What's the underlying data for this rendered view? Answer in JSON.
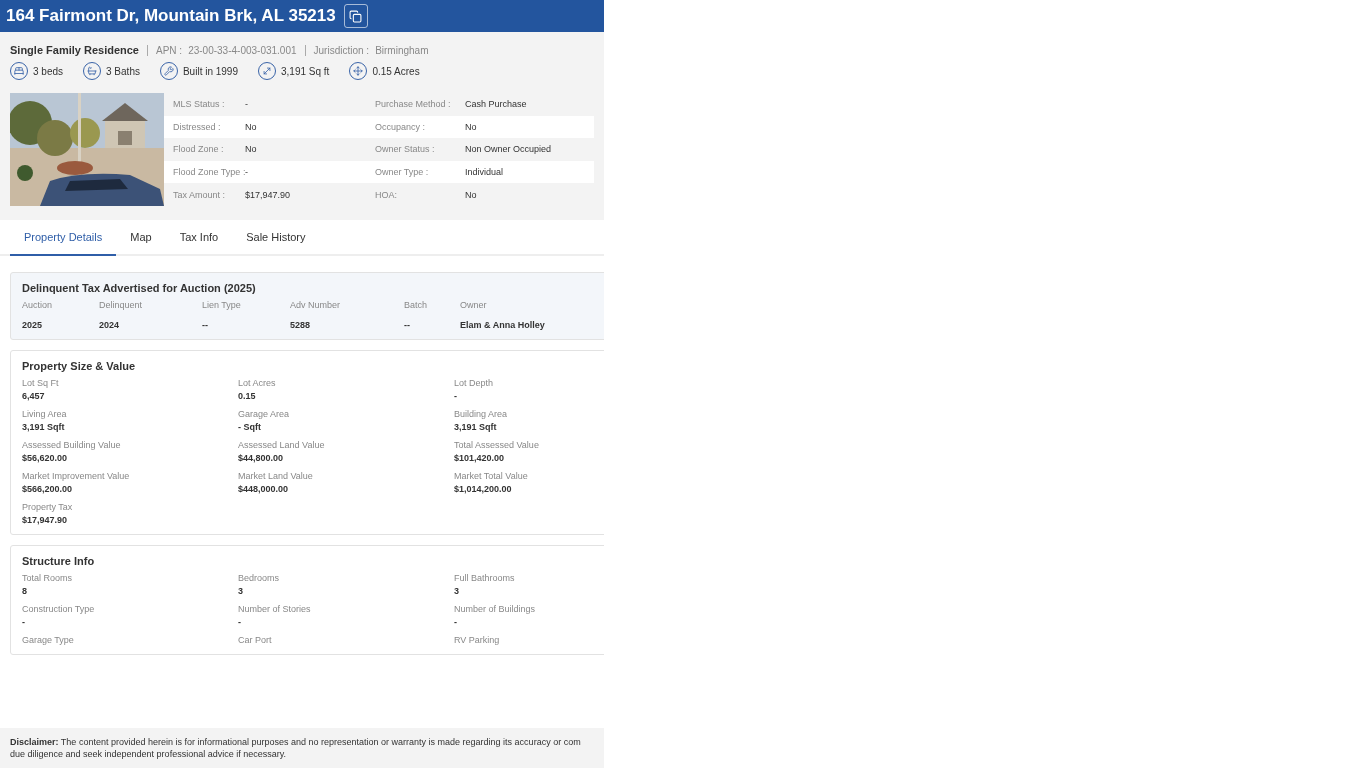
{
  "header": {
    "address": "164 Fairmont Dr, Mountain Brk, AL 35213"
  },
  "summary": {
    "type": "Single Family Residence",
    "apn_label": "APN :",
    "apn": "23-00-33-4-003-031.001",
    "jurisdiction_label": "Jurisdiction :",
    "jurisdiction": "Birmingham"
  },
  "features": [
    {
      "kind": "bed",
      "text": "3 beds"
    },
    {
      "kind": "bath",
      "text": "3 Baths"
    },
    {
      "kind": "built",
      "text": "Built in 1999"
    },
    {
      "kind": "area",
      "text": "3,191 Sq ft"
    },
    {
      "kind": "lot",
      "text": "0.15 Acres"
    }
  ],
  "details": [
    {
      "label": "MLS Status :",
      "value": "-",
      "label2": "Purchase Method :",
      "value2": "Cash Purchase"
    },
    {
      "label": "Distressed :",
      "value": "No",
      "label2": "Occupancy :",
      "value2": "No"
    },
    {
      "label": "Flood Zone :",
      "value": "No",
      "label2": "Owner Status :",
      "value2": "Non Owner Occupied"
    },
    {
      "label": "Flood Zone Type :",
      "value": "-",
      "label2": "Owner Type :",
      "value2": "Individual"
    },
    {
      "label": "Tax Amount :",
      "value": "$17,947.90",
      "label2": "HOA:",
      "value2": "No"
    }
  ],
  "tabs": [
    {
      "label": "Property Details",
      "selected": true
    },
    {
      "label": "Map",
      "selected": false
    },
    {
      "label": "Tax Info",
      "selected": false
    },
    {
      "label": "Sale History",
      "selected": false
    }
  ],
  "delinquent": {
    "title": "Delinquent Tax Advertised for Auction (2025)",
    "columns": [
      "Auction",
      "Delinquent",
      "Lien Type",
      "Adv Number",
      "Batch",
      "Owner"
    ],
    "values": [
      "2025",
      "2024",
      "--",
      "5288",
      "--",
      "Elam & Anna Holley"
    ]
  },
  "sections": [
    {
      "title": "Property Size & Value",
      "fields": [
        {
          "label": "Lot Sq Ft",
          "value": "6,457"
        },
        {
          "label": "Lot Acres",
          "value": "0.15"
        },
        {
          "label": "Lot Depth",
          "value": "-"
        },
        {
          "label": "Living Area",
          "value": "3,191 Sqft"
        },
        {
          "label": "Garage Area",
          "value": "- Sqft"
        },
        {
          "label": "Building Area",
          "value": "3,191 Sqft"
        },
        {
          "label": "Assessed Building Value",
          "value": "$56,620.00"
        },
        {
          "label": "Assessed Land Value",
          "value": "$44,800.00"
        },
        {
          "label": "Total Assessed Value",
          "value": "$101,420.00"
        },
        {
          "label": "Market Improvement Value",
          "value": "$566,200.00"
        },
        {
          "label": "Market Land Value",
          "value": "$448,000.00"
        },
        {
          "label": "Market Total Value",
          "value": "$1,014,200.00"
        },
        {
          "label": "Property Tax",
          "value": "$17,947.90"
        }
      ]
    },
    {
      "title": "Structure Info",
      "fields": [
        {
          "label": "Total Rooms",
          "value": "8"
        },
        {
          "label": "Bedrooms",
          "value": "3"
        },
        {
          "label": "Full Bathrooms",
          "value": "3"
        },
        {
          "label": "Construction Type",
          "value": "-"
        },
        {
          "label": "Number of Stories",
          "value": "-"
        },
        {
          "label": "Number of Buildings",
          "value": "-"
        },
        {
          "label": "Garage Type"
        },
        {
          "label": "Car Port"
        },
        {
          "label": "RV Parking"
        }
      ]
    }
  ],
  "disclaimer": {
    "text": "**Disclaimer:** The content provided herein is for informational purposes and no representation or warranty is made regarding its accuracy or com",
    "text2": "due diligence and seek independent professional advice if necessary."
  }
}
